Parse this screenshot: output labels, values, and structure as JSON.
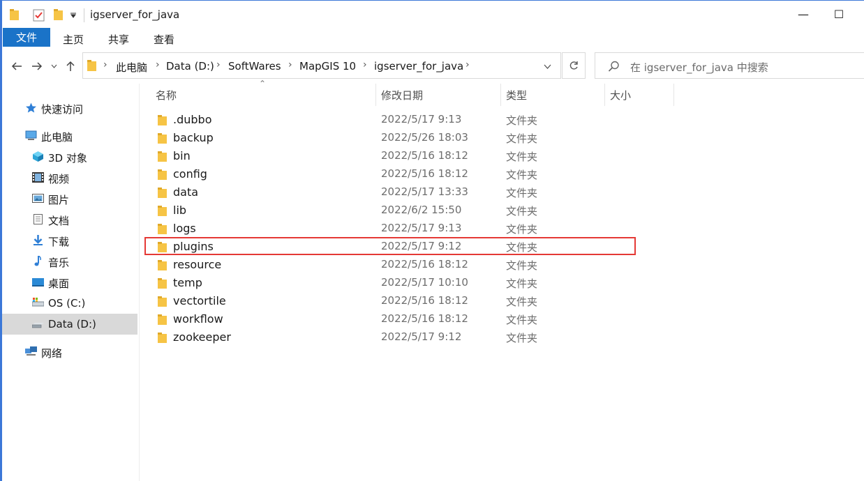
{
  "window": {
    "title": "igserver_for_java",
    "minimize_glyph": "—",
    "maximize_glyph": "☐"
  },
  "ribbon": {
    "tabs": [
      "文件",
      "主页",
      "共享",
      "查看"
    ]
  },
  "address": {
    "breadcrumbs": [
      "此电脑",
      "Data (D:)",
      "SoftWares",
      "MapGIS 10",
      "igserver_for_java"
    ],
    "search_placeholder": "在 igserver_for_java 中搜索"
  },
  "sidebar": {
    "items": [
      {
        "label": "快速访问",
        "icon": "star-icon"
      },
      {
        "label": "此电脑",
        "icon": "computer-icon"
      },
      {
        "label": "3D 对象",
        "icon": "cube-icon"
      },
      {
        "label": "视频",
        "icon": "film-icon"
      },
      {
        "label": "图片",
        "icon": "picture-icon"
      },
      {
        "label": "文档",
        "icon": "document-icon"
      },
      {
        "label": "下载",
        "icon": "download-icon"
      },
      {
        "label": "音乐",
        "icon": "music-icon"
      },
      {
        "label": "桌面",
        "icon": "desktop-icon"
      },
      {
        "label": "OS (C:)",
        "icon": "drive-icon"
      },
      {
        "label": "Data (D:)",
        "icon": "drive-icon",
        "selected": true
      },
      {
        "label": "网络",
        "icon": "network-icon"
      }
    ]
  },
  "columns": {
    "name": "名称",
    "modified": "修改日期",
    "type": "类型",
    "size": "大小"
  },
  "files": [
    {
      "name": ".dubbo",
      "date": "2022/5/17 9:13",
      "type": "文件夹"
    },
    {
      "name": "backup",
      "date": "2022/5/26 18:03",
      "type": "文件夹"
    },
    {
      "name": "bin",
      "date": "2022/5/16 18:12",
      "type": "文件夹"
    },
    {
      "name": "config",
      "date": "2022/5/16 18:12",
      "type": "文件夹"
    },
    {
      "name": "data",
      "date": "2022/5/17 13:33",
      "type": "文件夹"
    },
    {
      "name": "lib",
      "date": "2022/6/2 15:50",
      "type": "文件夹"
    },
    {
      "name": "logs",
      "date": "2022/5/17 9:13",
      "type": "文件夹"
    },
    {
      "name": "plugins",
      "date": "2022/5/17 9:12",
      "type": "文件夹",
      "highlighted": true
    },
    {
      "name": "resource",
      "date": "2022/5/16 18:12",
      "type": "文件夹"
    },
    {
      "name": "temp",
      "date": "2022/5/17 10:10",
      "type": "文件夹"
    },
    {
      "name": "vectortile",
      "date": "2022/5/16 18:12",
      "type": "文件夹"
    },
    {
      "name": "workflow",
      "date": "2022/5/16 18:12",
      "type": "文件夹"
    },
    {
      "name": "zookeeper",
      "date": "2022/5/17 9:12",
      "type": "文件夹"
    }
  ],
  "colors": {
    "accent": "#1a73c8",
    "highlight_border": "#e53935",
    "folder": "#f6c445"
  }
}
